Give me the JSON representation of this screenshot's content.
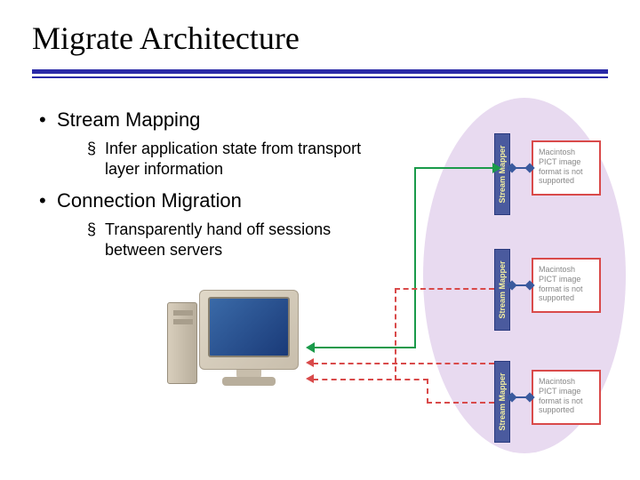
{
  "title": "Migrate Architecture",
  "bullets": {
    "main1": "Stream Mapping",
    "sub1": "Infer application state from transport layer information",
    "main2": "Connection Migration",
    "sub2": "Transparently hand off sessions between servers"
  },
  "mapper_label": "Stream Mapper",
  "placeholder_text": "Macintosh PICT image format is not supported",
  "colors": {
    "accent": "#2a2aa8",
    "ellipse": "#e8daf0",
    "mapper": "#4a5a9e",
    "green": "#1a9a4a",
    "red": "#d94a4a"
  }
}
